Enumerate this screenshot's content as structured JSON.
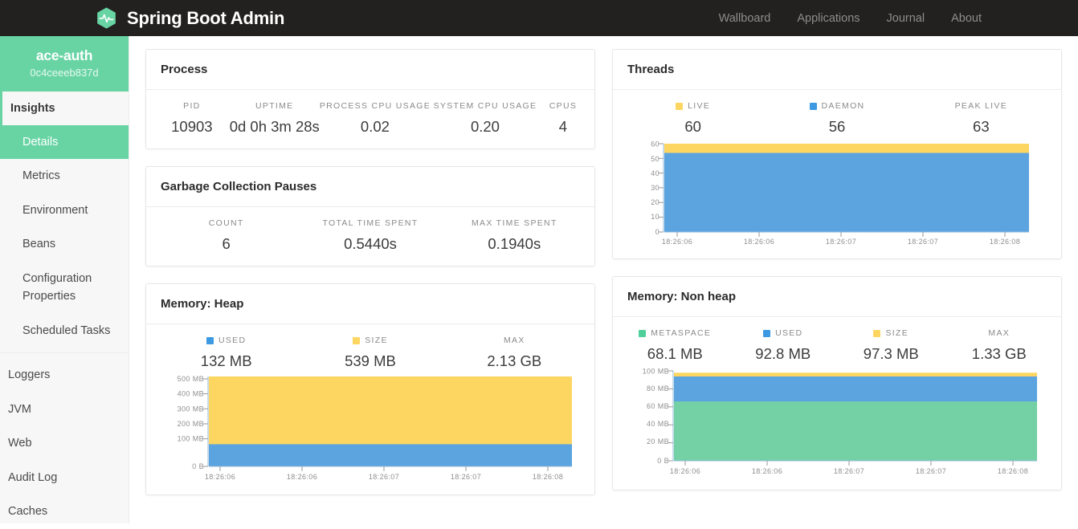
{
  "navbar": {
    "brand": "Spring Boot Admin",
    "logo_icon": "heartbeat-hexagon-icon",
    "links": [
      {
        "label": "Wallboard"
      },
      {
        "label": "Applications"
      },
      {
        "label": "Journal"
      },
      {
        "label": "About"
      }
    ]
  },
  "sidebar": {
    "instance_name": "ace-auth",
    "instance_id": "0c4ceeeb837d",
    "section_title": "Insights",
    "insight_items": [
      {
        "label": "Details",
        "active": true
      },
      {
        "label": "Metrics",
        "active": false
      },
      {
        "label": "Environment",
        "active": false
      },
      {
        "label": "Beans",
        "active": false
      },
      {
        "label": "Configuration Properties",
        "active": false
      },
      {
        "label": "Scheduled Tasks",
        "active": false
      }
    ],
    "root_items": [
      {
        "label": "Loggers"
      },
      {
        "label": "JVM"
      },
      {
        "label": "Web"
      },
      {
        "label": "Audit Log"
      },
      {
        "label": "Caches"
      }
    ]
  },
  "colors": {
    "brand_green": "#68d4a4",
    "series_used_blue": "#5ba4e0",
    "series_size_yellow": "#fcd661",
    "series_metaspace_green": "#74d1a5",
    "navbar_dark": "#23211f"
  },
  "cards": {
    "process": {
      "title": "Process",
      "stats": [
        {
          "label": "PID",
          "value": "10903"
        },
        {
          "label": "Uptime",
          "value": "0d 0h 3m 28s"
        },
        {
          "label": "Process CPU Usage",
          "value": "0.02"
        },
        {
          "label": "System CPU Usage",
          "value": "0.20"
        },
        {
          "label": "CPUs",
          "value": "4"
        }
      ]
    },
    "gc": {
      "title": "Garbage Collection Pauses",
      "stats": [
        {
          "label": "Count",
          "value": "6"
        },
        {
          "label": "Total Time Spent",
          "value": "0.5440s"
        },
        {
          "label": "Max Time Spent",
          "value": "0.1940s"
        }
      ]
    },
    "threads": {
      "title": "Threads",
      "stats": [
        {
          "label": "Live",
          "value": "60",
          "color": "#fcd661"
        },
        {
          "label": "Daemon",
          "value": "56",
          "color": "#3d9ae2"
        },
        {
          "label": "Peak Live",
          "value": "63",
          "color": null
        }
      ]
    },
    "heap": {
      "title": "Memory: Heap",
      "stats": [
        {
          "label": "Used",
          "value": "132 MB",
          "color": "#3d9ae2"
        },
        {
          "label": "Size",
          "value": "539 MB",
          "color": "#fcd661"
        },
        {
          "label": "Max",
          "value": "2.13 GB",
          "color": null
        }
      ]
    },
    "nonheap": {
      "title": "Memory: Non heap",
      "stats": [
        {
          "label": "Metaspace",
          "value": "68.1 MB",
          "color": "#4fcf99"
        },
        {
          "label": "Used",
          "value": "92.8 MB",
          "color": "#3d9ae2"
        },
        {
          "label": "Size",
          "value": "97.3 MB",
          "color": "#fcd661"
        },
        {
          "label": "Max",
          "value": "1.33 GB",
          "color": null
        }
      ]
    }
  },
  "chart_data": [
    {
      "type": "area",
      "name": "threads-chart",
      "title": "Threads",
      "x": [
        "18:26:06",
        "18:26:06",
        "18:26:07",
        "18:26:07",
        "18:26:08"
      ],
      "xlabel": "",
      "ylabel": "",
      "ylim": [
        0,
        60
      ],
      "yticks": [
        0,
        10,
        20,
        30,
        40,
        50,
        60
      ],
      "ytick_labels": [
        "0",
        "10",
        "20",
        "30",
        "40",
        "50",
        "60"
      ],
      "grid": false,
      "legend": "top",
      "series": [
        {
          "name": "Live",
          "color": "#fcd661",
          "values": [
            60,
            60,
            60,
            60,
            60
          ]
        },
        {
          "name": "Daemon",
          "color": "#5ba4e0",
          "values": [
            56,
            56,
            56,
            56,
            56
          ]
        }
      ]
    },
    {
      "type": "area",
      "name": "heap-memory-chart",
      "title": "Memory: Heap",
      "x": [
        "18:26:06",
        "18:26:06",
        "18:26:07",
        "18:26:07",
        "18:26:08"
      ],
      "xlabel": "",
      "ylabel": "",
      "ylim": [
        0,
        600
      ],
      "yticks": [
        0,
        100,
        200,
        300,
        400,
        500
      ],
      "ytick_labels": [
        "0 B",
        "100 MB",
        "200 MB",
        "300 MB",
        "400 MB",
        "500 MB"
      ],
      "grid": false,
      "legend": "top",
      "series": [
        {
          "name": "Size",
          "color": "#fcd661",
          "values": [
            539,
            539,
            539,
            539,
            539
          ]
        },
        {
          "name": "Used",
          "color": "#5ba4e0",
          "values": [
            132,
            132,
            132,
            132,
            132
          ]
        }
      ]
    },
    {
      "type": "area",
      "name": "nonheap-memory-chart",
      "title": "Memory: Non heap",
      "x": [
        "18:26:06",
        "18:26:06",
        "18:26:07",
        "18:26:07",
        "18:26:08"
      ],
      "xlabel": "",
      "ylabel": "",
      "ylim": [
        0,
        105
      ],
      "yticks": [
        0,
        20,
        40,
        60,
        80,
        100
      ],
      "ytick_labels": [
        "0 B",
        "20 MB",
        "40 MB",
        "60 MB",
        "80 MB",
        "100 MB"
      ],
      "grid": false,
      "legend": "top",
      "series": [
        {
          "name": "Size",
          "color": "#fcd661",
          "values": [
            97.3,
            97.3,
            97.3,
            97.3,
            97.3
          ]
        },
        {
          "name": "Used",
          "color": "#5ba4e0",
          "values": [
            92.8,
            92.8,
            92.8,
            92.8,
            92.8
          ]
        },
        {
          "name": "Metaspace",
          "color": "#74d1a5",
          "values": [
            68.1,
            68.1,
            68.1,
            68.1,
            68.1
          ]
        }
      ]
    }
  ]
}
